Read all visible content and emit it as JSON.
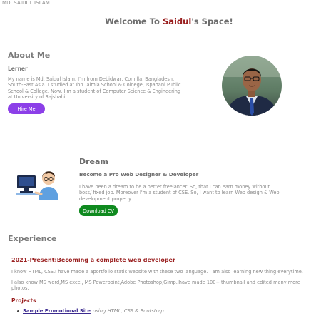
{
  "brand": "MD. SAIDUL ISLAM",
  "welcome": {
    "prefix": "Welcome To ",
    "name": "Saidul",
    "suffix": "'s Space!"
  },
  "about": {
    "title": "About Me",
    "subtitle": "Lerner",
    "text": "My name is Md. Saidul Islam. I'm from Debidwar, Comilla, Bangladesh, South-East Asia. I studied at Ibn Taimia School & Coloege, Ispahani Public School & College. Now, I'm a student of Computer Science & Engineering at University of Rajshahi.",
    "button": "Hire Me"
  },
  "dream": {
    "title": "Dream",
    "subtitle": "Become a Pro Web Designer & Developer",
    "text": "I have been a dream to be a better freelancer. So, that I can earn money without boss/ fixed job. Moreover I'm a student of CSE. So, I want to learn Web design & Web development properly.",
    "button": "Download CV"
  },
  "experience": {
    "title": "Experience",
    "role": "2021-Present:Becoming a complete web developer",
    "p1": "I know HTML, CSS.I have made a aportfolio static website with these two language. I am also learning new thing everytime.",
    "p2": "I also know MS word,MS excel, MS Powerpoint,Adobe Photoshop,Gimp.Ihave made 100+ thumbnail and edited many more photos.",
    "projects_label": "Projects",
    "projects": [
      {
        "name": "Sample Promotional Site",
        "desc": "using HTML, CSS & Bootstrap"
      }
    ]
  },
  "colors": {
    "accent_red": "#9a1f1f",
    "hire_purple": "#8c3fe8",
    "download_green": "#0f8a1f",
    "link_blue": "#3b2a8f"
  }
}
